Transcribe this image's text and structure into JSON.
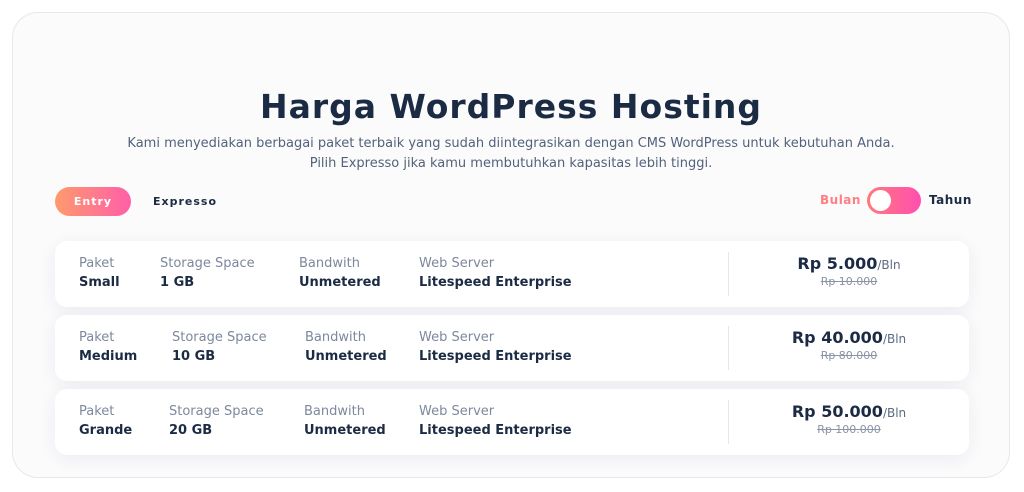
{
  "header": {
    "title": "Harga WordPress Hosting",
    "subtitle_line1": "Kami menyediakan berbagai paket terbaik yang sudah diintegrasikan dengan CMS WordPress untuk kebutuhan Anda.",
    "subtitle_line2": "Pilih Expresso jika kamu membutuhkan kapasitas lebih tinggi."
  },
  "tabs": {
    "entry": "Entry",
    "expresso": "Expresso",
    "active": "Entry"
  },
  "billing": {
    "monthly": "Bulan",
    "yearly": "Tahun",
    "selected": "Bulan"
  },
  "labels": {
    "paket": "Paket",
    "storage": "Storage Space",
    "bandwidth": "Bandwith",
    "server": "Web Server",
    "per": "/Bln"
  },
  "plans": [
    {
      "name": "Small",
      "storage": "1 GB",
      "bandwidth": "Unmetered",
      "server": "Litespeed Enterprise",
      "price": "Rp 5.000",
      "old_price": "Rp 10.000"
    },
    {
      "name": "Medium",
      "storage": "10 GB",
      "bandwidth": "Unmetered",
      "server": "Litespeed Enterprise",
      "price": "Rp 40.000",
      "old_price": "Rp 80.000"
    },
    {
      "name": "Grande",
      "storage": "20 GB",
      "bandwidth": "Unmetered",
      "server": "Litespeed Enterprise",
      "price": "Rp 50.000",
      "old_price": "Rp 100.000"
    }
  ],
  "colors": {
    "accent_start": "#fe9a6e",
    "accent_end": "#ff5fa8",
    "text_dark": "#1c2b44",
    "text_muted": "#7c889c"
  }
}
